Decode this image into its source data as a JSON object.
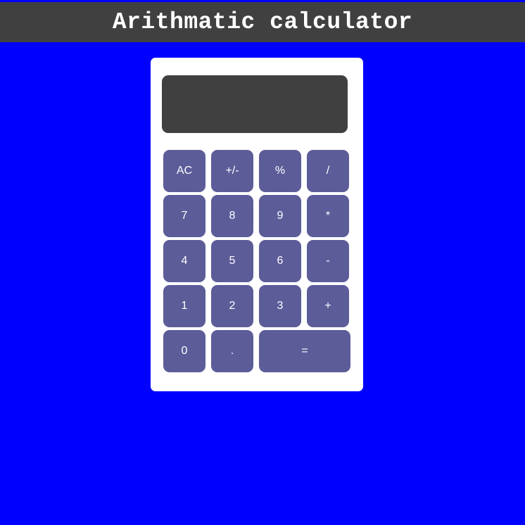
{
  "header": {
    "title": "Arithmatic calculator"
  },
  "display": {
    "value": ""
  },
  "keys": {
    "ac": "AC",
    "sign": "+/-",
    "percent": "%",
    "divide": "/",
    "seven": "7",
    "eight": "8",
    "nine": "9",
    "multiply": "*",
    "four": "4",
    "five": "5",
    "six": "6",
    "subtract": "-",
    "one": "1",
    "two": "2",
    "three": "3",
    "add": "+",
    "zero": "0",
    "decimal": ".",
    "equals": "="
  },
  "colors": {
    "page_background": "#0000ff",
    "header_background": "#404040",
    "calculator_body": "#ffffff",
    "display_background": "#404040",
    "key_background": "#5c5c99",
    "key_text": "#ffffff"
  }
}
